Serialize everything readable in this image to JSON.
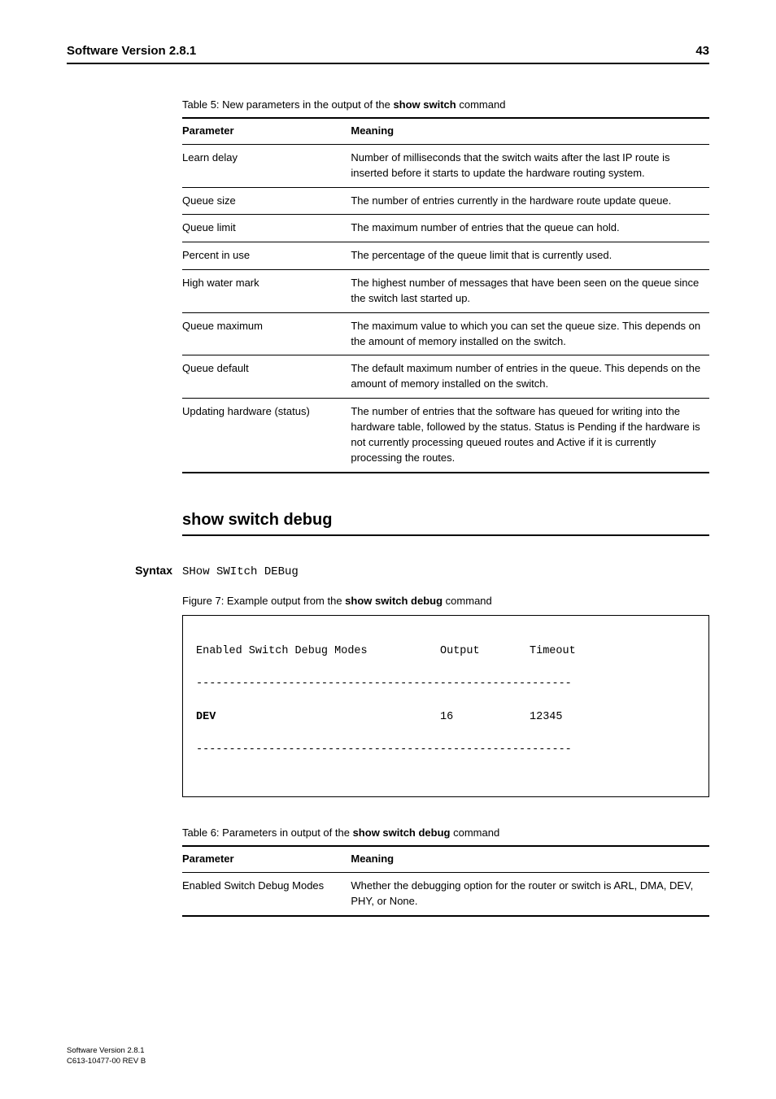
{
  "header": {
    "title": "Software Version 2.8.1",
    "page": "43"
  },
  "table5": {
    "caption_prefix": "Table 5: New parameters in the output of the ",
    "caption_bold": "show switch",
    "caption_suffix": " command",
    "head_param": "Parameter",
    "head_meaning": "Meaning",
    "rows": [
      {
        "param": "Learn delay",
        "meaning": "Number of milliseconds that the switch waits after the last IP route is inserted before it starts to update the hardware routing system."
      },
      {
        "param": "Queue size",
        "meaning": "The number of entries currently in the hardware route update queue."
      },
      {
        "param": "Queue limit",
        "meaning": "The maximum number of entries that the queue can hold."
      },
      {
        "param": "Percent in use",
        "meaning": "The percentage of the queue limit that is currently used."
      },
      {
        "param": "High water mark",
        "meaning": "The highest number of messages that have been seen on the queue since the switch last started up."
      },
      {
        "param": "Queue maximum",
        "meaning": "The maximum value to which you can set the queue size. This depends on the amount of memory installed on the switch."
      },
      {
        "param": "Queue default",
        "meaning": "The default maximum number of entries in the queue. This depends on the amount of memory installed on the switch."
      },
      {
        "param": "Updating hardware (status)",
        "meaning": "The number of entries that the software has queued for writing into the hardware table, followed by the status. Status is Pending if the hardware is not currently processing queued routes and Active if it is currently processing the routes."
      }
    ]
  },
  "section": {
    "heading": "show switch debug"
  },
  "syntax": {
    "label": "Syntax",
    "code": "SHow SWItch DEBug"
  },
  "figure": {
    "caption_prefix": "Figure 7: Example output from the ",
    "caption_bold": "show switch debug",
    "caption_suffix": " command",
    "head": {
      "c1": "Enabled Switch Debug Modes",
      "c2": "Output",
      "c3": "Timeout"
    },
    "rule": "---------------------------------------------------------",
    "row": {
      "c1": "DEV",
      "c2": "16",
      "c3": "12345"
    }
  },
  "table6": {
    "caption_prefix": "Table 6: Parameters in output of the ",
    "caption_bold": "show switch debug",
    "caption_suffix": " command",
    "head_param": "Parameter",
    "head_meaning": "Meaning",
    "rows": [
      {
        "param": "Enabled Switch Debug Modes",
        "meaning_pre": "Whether the debugging option for the router or switch is ARL, DMA, ",
        "meaning_bold": "DEV",
        "meaning_post": ", PHY, or None."
      }
    ]
  },
  "footer": {
    "line1": "Software Version 2.8.1",
    "line2": "C613-10477-00 REV B"
  }
}
